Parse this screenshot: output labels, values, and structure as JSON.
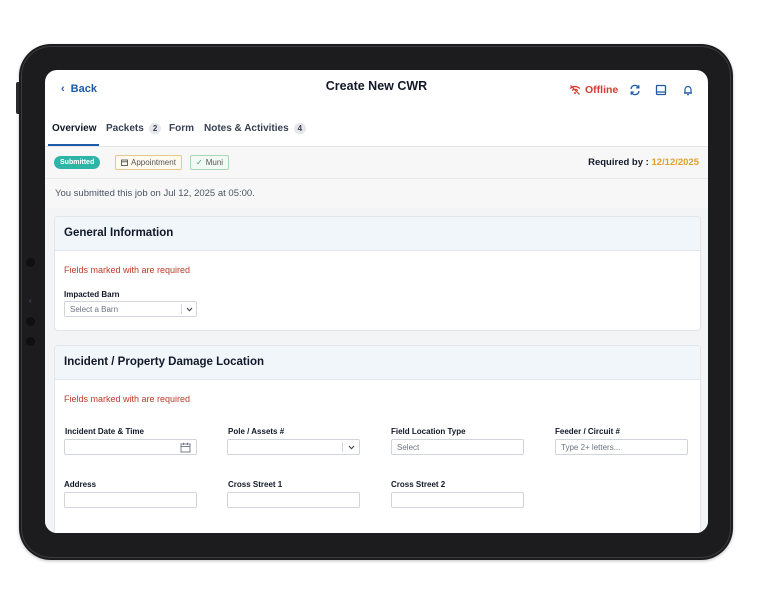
{
  "header": {
    "back_label": "Back",
    "title": "Create New CWR",
    "offline_label": "Offline",
    "icons": [
      "refresh-icon",
      "tablet-icon",
      "bell-icon"
    ]
  },
  "tabs": [
    {
      "label": "Overview",
      "count": null,
      "active": true
    },
    {
      "label": "Packets",
      "count": "2",
      "active": false
    },
    {
      "label": "Form",
      "count": null,
      "active": false
    },
    {
      "label": "Notes & Activities",
      "count": "4",
      "active": false
    }
  ],
  "status": {
    "badge": "Submitted",
    "chips": [
      "Appointment",
      "Muni"
    ],
    "required_label": "Required by :",
    "required_date": "12/12/2025"
  },
  "submitted_message": "You submitted this job on Jul 12, 2025 at 05:00.",
  "sections": {
    "general": {
      "title": "General Information",
      "note": "Fields marked with  are required",
      "impacted_barn_label": "Impacted Barn",
      "impacted_barn_placeholder": "Select a Barn"
    },
    "incident": {
      "title": "Incident / Property Damage Location",
      "note": "Fields marked with  are required",
      "fields": {
        "incident_date": {
          "label": "Incident Date & Time",
          "value": ""
        },
        "pole_assets": {
          "label": "Pole / Assets #",
          "value": ""
        },
        "field_location": {
          "label": "Field Location Type",
          "placeholder": "Select"
        },
        "feeder_circuit": {
          "label": "Feeder / Circuit  #",
          "placeholder": "Type 2+ letters..."
        },
        "address": {
          "label": "Address",
          "value": ""
        },
        "cross_street_1": {
          "label": "Cross Street 1",
          "value": ""
        },
        "cross_street_2": {
          "label": "Cross Street 2",
          "value": ""
        }
      }
    }
  },
  "colors": {
    "accent": "#1e5aa8",
    "offline": "#d73a2f",
    "badge": "#2fb5a8",
    "required_date": "#e0a12a",
    "note": "#c0392b"
  }
}
